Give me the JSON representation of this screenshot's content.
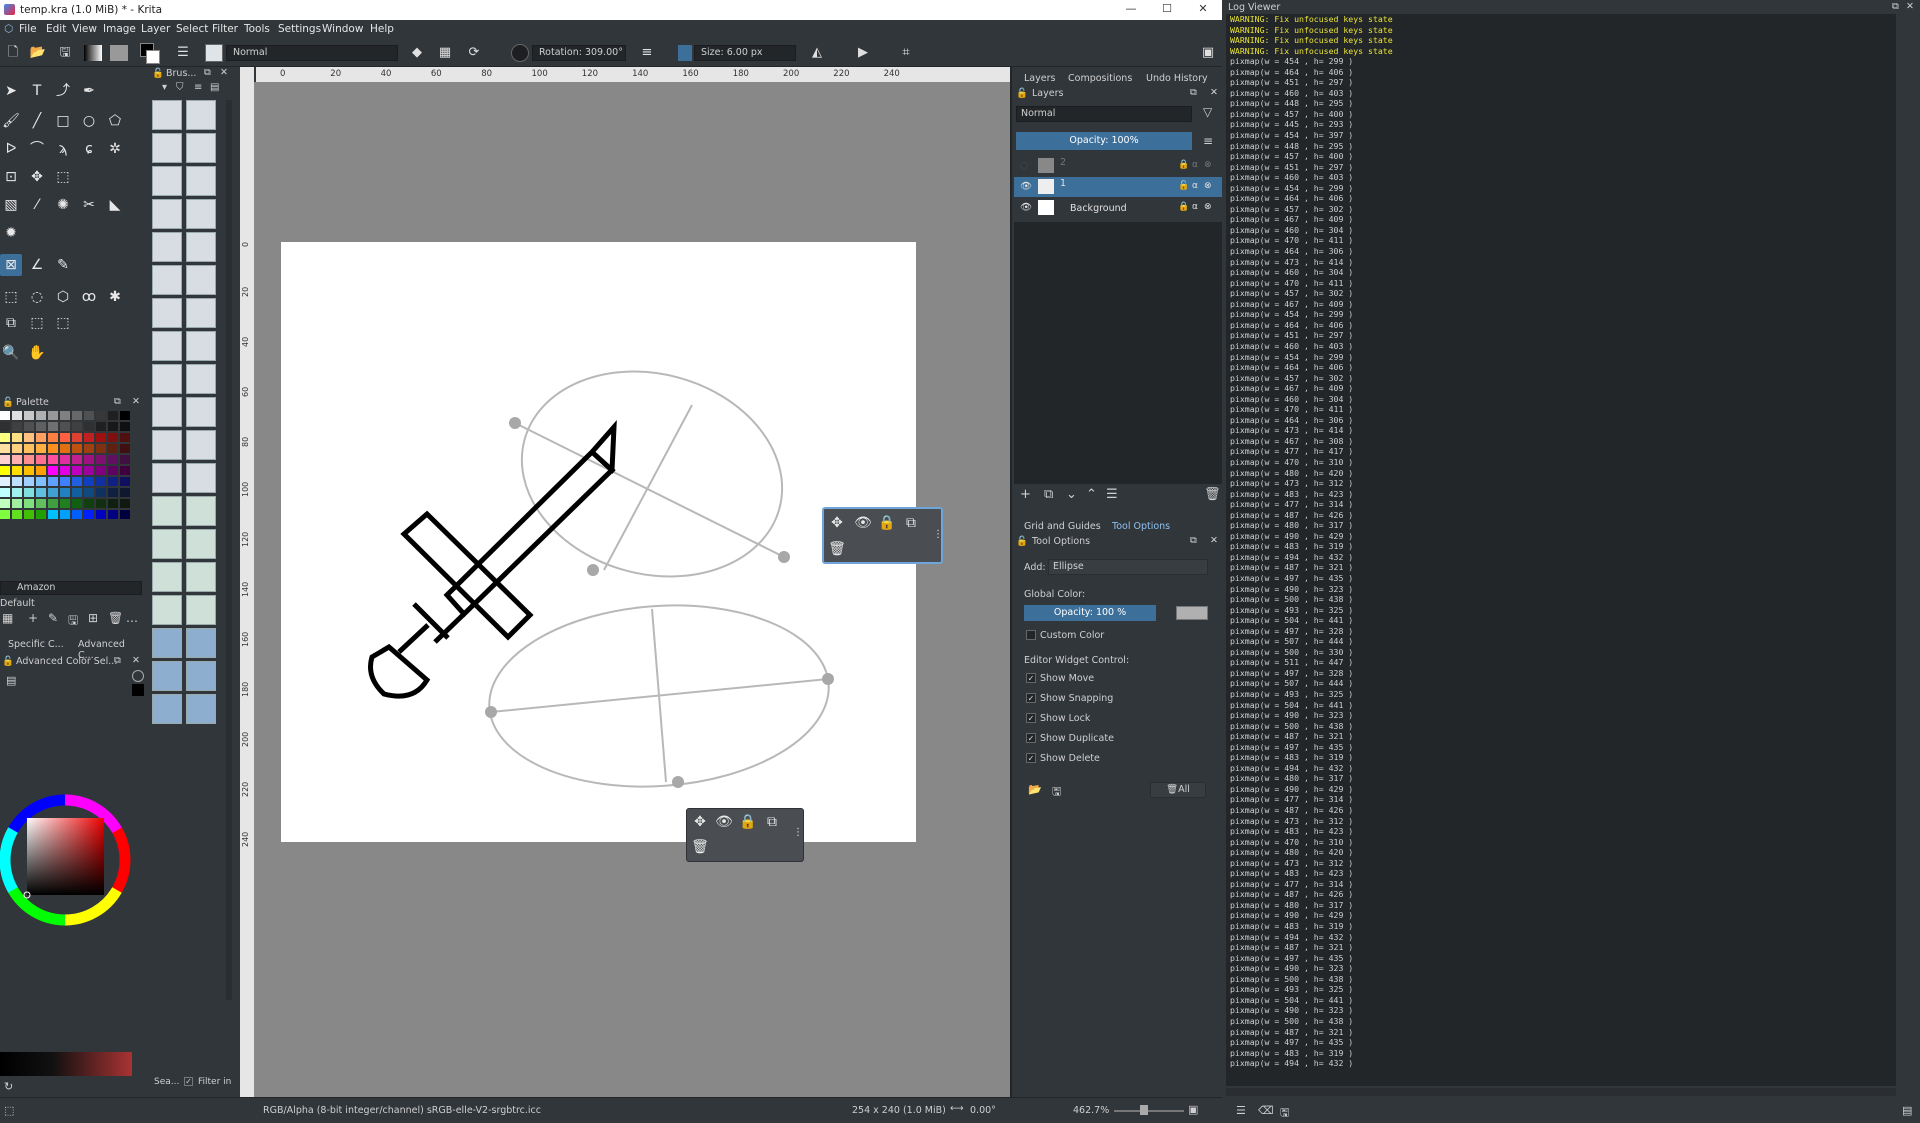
{
  "window": {
    "title": "temp.kra (1.0 MiB) * - Krita",
    "min": "—",
    "max": "☐",
    "close": "✕"
  },
  "menu": [
    "File",
    "Edit",
    "View",
    "Image",
    "Layer",
    "Select",
    "Filter",
    "Tools",
    "Settings",
    "Window",
    "Help"
  ],
  "toolbar": {
    "blend_mode": "Normal",
    "rotation": "Rotation: 309.00°",
    "size": "Size: 6.00 px"
  },
  "brushes_docker": {
    "title": "Brus..."
  },
  "palette_docker": {
    "title": "Palette",
    "palette_name": "Amazon",
    "default_label": "Default"
  },
  "selector_tabs": [
    "Specific C...",
    "Advanced C..."
  ],
  "adv_color_docker": {
    "title": "Advanced Color Sel..."
  },
  "bottom_left": {
    "search": "Sea...",
    "filter": "Filter in"
  },
  "ruler_top": [
    "0",
    "20",
    "40",
    "60",
    "80",
    "100",
    "120",
    "140",
    "160",
    "180",
    "200",
    "220",
    "240"
  ],
  "ruler_left": [
    "0",
    "20",
    "40",
    "60",
    "80",
    "100",
    "120",
    "140",
    "160",
    "180",
    "200",
    "220",
    "240"
  ],
  "right_tabs": [
    "Layers",
    "Compositions",
    "Undo History"
  ],
  "layers": {
    "title": "Layers",
    "blend_mode": "Normal",
    "opacity": "Opacity: 100%",
    "items": [
      {
        "name": "2",
        "visible": false
      },
      {
        "name": "1",
        "visible": true,
        "selected": true
      },
      {
        "name": "Background",
        "visible": true
      }
    ]
  },
  "bottom_tabs": [
    "Grid and Guides",
    "Tool Options"
  ],
  "tool_options": {
    "title": "Tool Options",
    "add_label": "Add:",
    "add_value": "Ellipse",
    "global_color": "Global Color:",
    "opacity": "Opacity: 100 %",
    "custom_color": "Custom Color",
    "widget_control": "Editor Widget Control:",
    "checks": [
      "Show Move",
      "Show Snapping",
      "Show Lock",
      "Show Duplicate",
      "Show Delete"
    ],
    "all_button": "All"
  },
  "status": {
    "colorspace": "RGB/Alpha (8-bit integer/channel)  sRGB-elle-V2-srgbtrc.icc",
    "dims": "254 x 240 (1.0 MiB)",
    "rotation": "0.00°",
    "zoom": "462.7%"
  },
  "log_viewer": {
    "title": "Log Viewer",
    "lines": [
      "WARNING: Fix unfocused keys state",
      "WARNING: Fix unfocused keys state",
      "WARNING: Fix unfocused keys state",
      "WARNING: Fix unfocused keys state",
      "pixmap(w = 454 , h= 299 )",
      "pixmap(w = 464 , h= 406 )",
      "pixmap(w = 451 , h= 297 )",
      "pixmap(w = 460 , h= 403 )",
      "pixmap(w = 448 , h= 295 )",
      "pixmap(w = 457 , h= 400 )",
      "pixmap(w = 445 , h= 293 )",
      "pixmap(w = 454 , h= 397 )",
      "pixmap(w = 448 , h= 295 )",
      "pixmap(w = 457 , h= 400 )",
      "pixmap(w = 451 , h= 297 )",
      "pixmap(w = 460 , h= 403 )",
      "pixmap(w = 454 , h= 299 )",
      "pixmap(w = 464 , h= 406 )",
      "pixmap(w = 457 , h= 302 )",
      "pixmap(w = 467 , h= 409 )",
      "pixmap(w = 460 , h= 304 )",
      "pixmap(w = 470 , h= 411 )",
      "pixmap(w = 464 , h= 306 )",
      "pixmap(w = 473 , h= 414 )",
      "pixmap(w = 460 , h= 304 )",
      "pixmap(w = 470 , h= 411 )",
      "pixmap(w = 457 , h= 302 )",
      "pixmap(w = 467 , h= 409 )",
      "pixmap(w = 454 , h= 299 )",
      "pixmap(w = 464 , h= 406 )",
      "pixmap(w = 451 , h= 297 )",
      "pixmap(w = 460 , h= 403 )",
      "pixmap(w = 454 , h= 299 )",
      "pixmap(w = 464 , h= 406 )",
      "pixmap(w = 457 , h= 302 )",
      "pixmap(w = 467 , h= 409 )",
      "pixmap(w = 460 , h= 304 )",
      "pixmap(w = 470 , h= 411 )",
      "pixmap(w = 464 , h= 306 )",
      "pixmap(w = 473 , h= 414 )",
      "pixmap(w = 467 , h= 308 )",
      "pixmap(w = 477 , h= 417 )",
      "pixmap(w = 470 , h= 310 )",
      "pixmap(w = 480 , h= 420 )",
      "pixmap(w = 473 , h= 312 )",
      "pixmap(w = 483 , h= 423 )",
      "pixmap(w = 477 , h= 314 )",
      "pixmap(w = 487 , h= 426 )",
      "pixmap(w = 480 , h= 317 )",
      "pixmap(w = 490 , h= 429 )",
      "pixmap(w = 483 , h= 319 )",
      "pixmap(w = 494 , h= 432 )",
      "pixmap(w = 487 , h= 321 )",
      "pixmap(w = 497 , h= 435 )",
      "pixmap(w = 490 , h= 323 )",
      "pixmap(w = 500 , h= 438 )",
      "pixmap(w = 493 , h= 325 )",
      "pixmap(w = 504 , h= 441 )",
      "pixmap(w = 497 , h= 328 )",
      "pixmap(w = 507 , h= 444 )",
      "pixmap(w = 500 , h= 330 )",
      "pixmap(w = 511 , h= 447 )",
      "pixmap(w = 497 , h= 328 )",
      "pixmap(w = 507 , h= 444 )",
      "pixmap(w = 493 , h= 325 )",
      "pixmap(w = 504 , h= 441 )",
      "pixmap(w = 490 , h= 323 )",
      "pixmap(w = 500 , h= 438 )",
      "pixmap(w = 487 , h= 321 )",
      "pixmap(w = 497 , h= 435 )",
      "pixmap(w = 483 , h= 319 )",
      "pixmap(w = 494 , h= 432 )",
      "pixmap(w = 480 , h= 317 )",
      "pixmap(w = 490 , h= 429 )",
      "pixmap(w = 477 , h= 314 )",
      "pixmap(w = 487 , h= 426 )",
      "pixmap(w = 473 , h= 312 )",
      "pixmap(w = 483 , h= 423 )",
      "pixmap(w = 470 , h= 310 )",
      "pixmap(w = 480 , h= 420 )",
      "pixmap(w = 473 , h= 312 )",
      "pixmap(w = 483 , h= 423 )",
      "pixmap(w = 477 , h= 314 )",
      "pixmap(w = 487 , h= 426 )",
      "pixmap(w = 480 , h= 317 )",
      "pixmap(w = 490 , h= 429 )",
      "pixmap(w = 483 , h= 319 )",
      "pixmap(w = 494 , h= 432 )",
      "pixmap(w = 487 , h= 321 )",
      "pixmap(w = 497 , h= 435 )",
      "pixmap(w = 490 , h= 323 )",
      "pixmap(w = 500 , h= 438 )",
      "pixmap(w = 493 , h= 325 )",
      "pixmap(w = 504 , h= 441 )",
      "pixmap(w = 490 , h= 323 )",
      "pixmap(w = 500 , h= 438 )",
      "pixmap(w = 487 , h= 321 )",
      "pixmap(w = 497 , h= 435 )",
      "pixmap(w = 483 , h= 319 )",
      "pixmap(w = 494 , h= 432 )"
    ]
  }
}
